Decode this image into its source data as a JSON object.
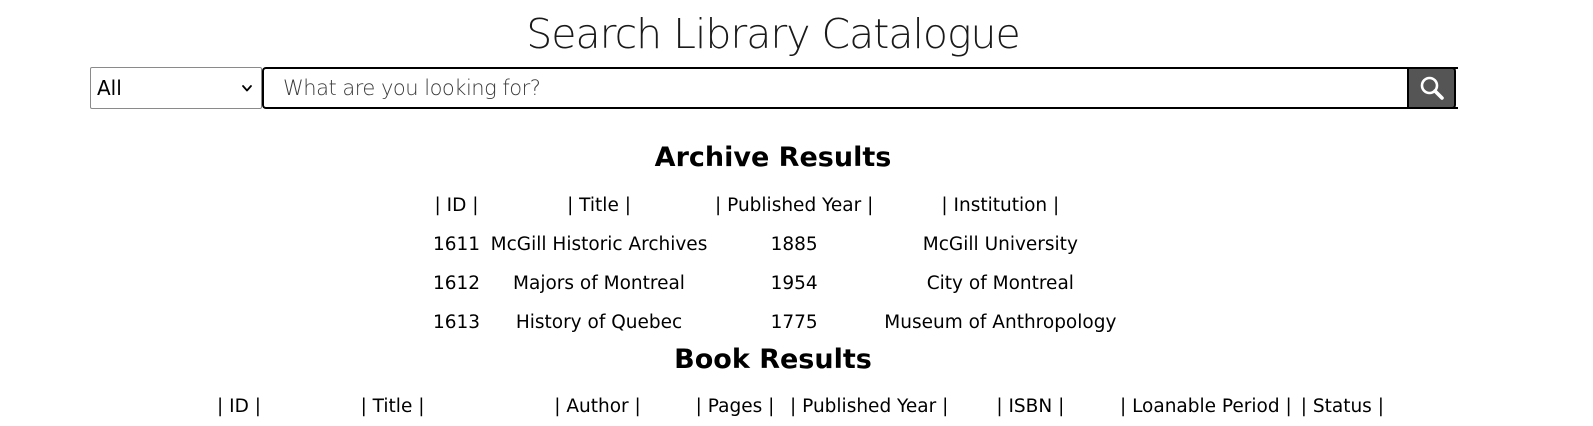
{
  "page": {
    "title": "Search Library Catalogue"
  },
  "search": {
    "category_selected": "All",
    "placeholder": "What are you looking for?",
    "value": "",
    "button_icon": "search-icon",
    "button_color": "#555555"
  },
  "archive": {
    "title": "Archive Results",
    "headers": [
      "| ID |",
      "| Title |",
      "| Published Year |",
      "| Institution |"
    ],
    "rows": [
      [
        "1611",
        "McGill Historic Archives",
        "1885",
        "McGill University"
      ],
      [
        "1612",
        "Majors of Montreal",
        "1954",
        "City of Montreal"
      ],
      [
        "1613",
        "History of Quebec",
        "1775",
        "Museum of Anthropology"
      ]
    ]
  },
  "books": {
    "title": "Book Results",
    "headers": [
      "| ID |",
      "| Title |",
      "| Author |",
      "| Pages |",
      "| Published Year |",
      "| ISBN |",
      "| Loanable Period |",
      "| Status |"
    ]
  }
}
